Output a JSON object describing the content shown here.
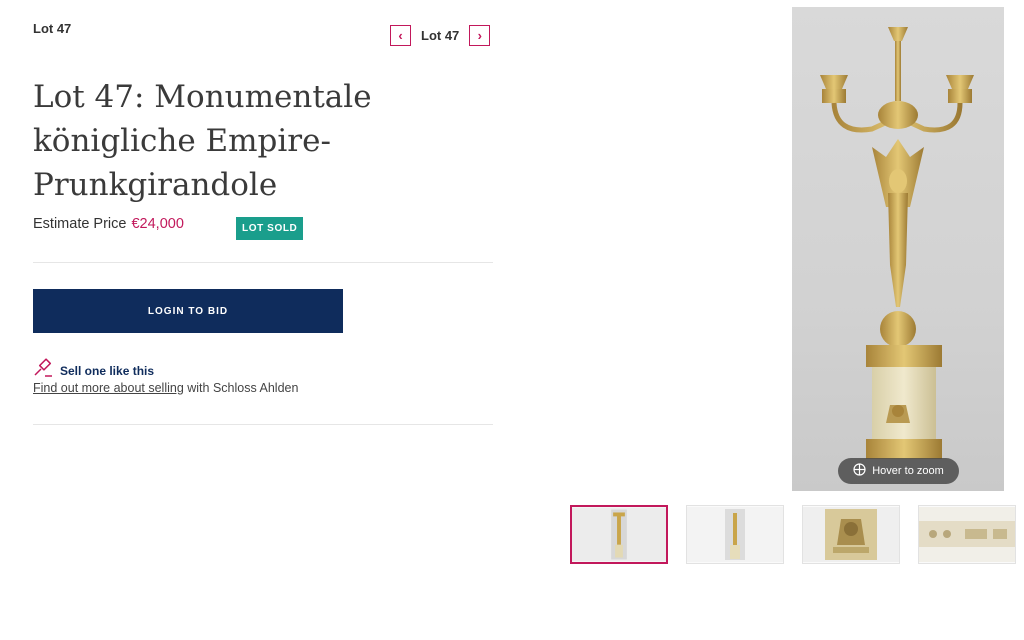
{
  "lot": {
    "label": "Lot 47",
    "nav_label": "Lot 47",
    "title": "Lot 47: Monumentale königliche Empire-Prunkgirandole",
    "estimate_label": "Estimate Price",
    "estimate_value": "€24,000",
    "status_badge": "LOT SOLD"
  },
  "actions": {
    "login_bid_label": "LOGIN TO BID"
  },
  "sell": {
    "title": "Sell one like this",
    "link_text": "Find out more about selling",
    "desc_suffix": " with Schloss Ahlden"
  },
  "gallery": {
    "zoom_label": "Hover to zoom",
    "thumbnail_count": 4,
    "active_thumbnail": 1
  },
  "colors": {
    "accent": "#c2185b",
    "button_navy": "#0f2c5c",
    "badge_teal": "#1a9e8c",
    "gold": "#c9a54a"
  },
  "icons": {
    "prev": "chevron-left-icon",
    "next": "chevron-right-icon",
    "sell": "gavel-icon",
    "zoom": "zoom-crosshair-icon"
  }
}
